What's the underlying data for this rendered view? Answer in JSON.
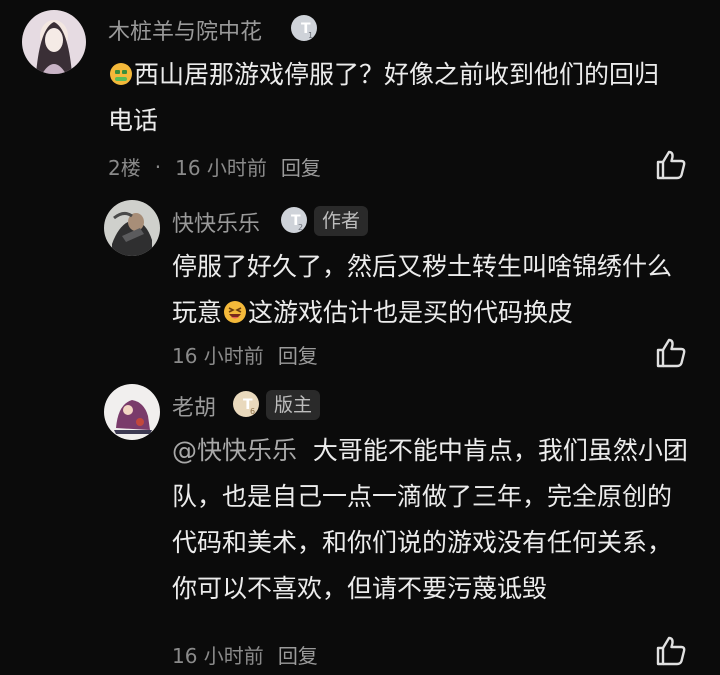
{
  "comments": [
    {
      "author": "木桩羊与院中花",
      "level": "1",
      "text_before_emoji": "",
      "text_after_emoji": "西山居那游戏停服了？好像之前收到他们的回归电话",
      "floor": "2楼",
      "separator": "·",
      "time": "16 小时前",
      "reply_label": "回复"
    },
    {
      "author": "快快乐乐",
      "level": "2",
      "tag": "作者",
      "text_before_emoji": "停服了好久了，然后又秽土转生叫啥锦绣什么玩意",
      "text_after_emoji": "这游戏估计也是买的代码换皮",
      "time": "16 小时前",
      "reply_label": "回复"
    },
    {
      "author": "老胡",
      "level": "6",
      "tag": "版主",
      "mention": "@快快乐乐",
      "text": "大哥能不能中肯点，我们虽然小团队，也是自己一点一滴做了三年，完全原创的代码和美术，和你们说的游戏没有任何关系，你可以不喜欢，但请不要污蔑诋毁",
      "time": "16 小时前",
      "reply_label": "回复"
    }
  ],
  "icons": {
    "like": "thumbs-up-outline-icon",
    "emoji_1": "money-mouth-emoji",
    "emoji_2": "grinning-squinting-emoji"
  },
  "colors": {
    "background": "#0b0b0b",
    "text": "#ececec",
    "muted": "#8a8a8a",
    "badge": "#e9d9bd"
  }
}
